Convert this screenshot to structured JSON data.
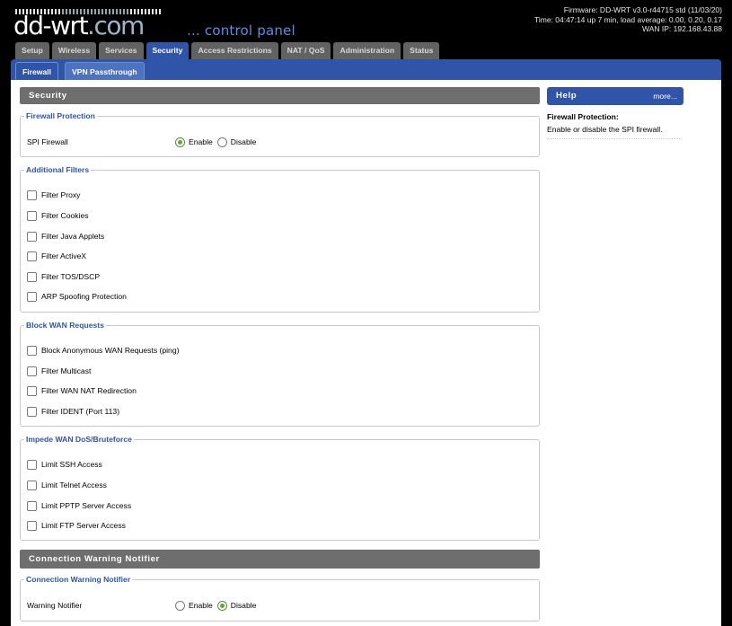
{
  "header": {
    "logo_main": "dd-wrt",
    "logo_com": ".com",
    "tagline": "... control panel",
    "firmware": "Firmware: DD-WRT v3.0-r44715 std (11/03/20)",
    "time": "Time: 04:47:14 up 7 min, load average: 0.00, 0.20, 0.17",
    "wan_ip": "WAN IP: 192.168.43.88"
  },
  "tabs": [
    "Setup",
    "Wireless",
    "Services",
    "Security",
    "Access Restrictions",
    "NAT / QoS",
    "Administration",
    "Status"
  ],
  "active_tab": "Security",
  "subtabs": [
    "Firewall",
    "VPN Passthrough"
  ],
  "security": {
    "title": "Security",
    "firewall_protection": {
      "legend": "Firewall Protection",
      "label": "SPI Firewall",
      "enable": "Enable",
      "disable": "Disable",
      "selected": "Enable"
    },
    "additional_filters": {
      "legend": "Additional Filters",
      "items": [
        "Filter Proxy",
        "Filter Cookies",
        "Filter Java Applets",
        "Filter ActiveX",
        "Filter TOS/DSCP",
        "ARP Spoofing Protection"
      ]
    },
    "block_wan": {
      "legend": "Block WAN Requests",
      "items": [
        "Block Anonymous WAN Requests (ping)",
        "Filter Multicast",
        "Filter WAN NAT Redirection",
        "Filter IDENT (Port 113)"
      ]
    },
    "impede": {
      "legend": "Impede WAN DoS/Bruteforce",
      "items": [
        "Limit SSH Access",
        "Limit Telnet Access",
        "Limit PPTP Server Access",
        "Limit FTP Server Access"
      ]
    }
  },
  "notifier": {
    "title": "Connection Warning Notifier",
    "legend": "Connection Warning Notifier",
    "label": "Warning Notifier",
    "enable": "Enable",
    "disable": "Disable",
    "selected": "Disable"
  },
  "help": {
    "title": "Help",
    "more": "more...",
    "heading": "Firewall Protection:",
    "text": "Enable or disable the SPI firewall."
  },
  "colors": {
    "accent": "#2f54a8",
    "section_gray": "#6e6e6e",
    "radio_on": "#6aa040"
  }
}
